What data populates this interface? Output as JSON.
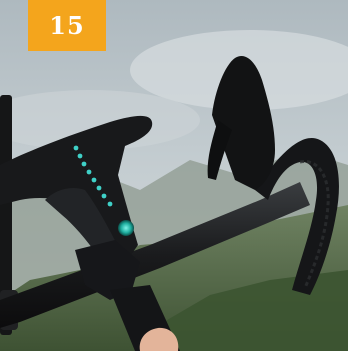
{
  "badge": {
    "number": "15",
    "bg_color": "#F4A51C",
    "text_color": "#FFFFFF"
  },
  "photo": {
    "subject": "bike-handlebar-with-led-light-strip",
    "led_color": "#3FD0C7",
    "sky_color": "#BFC8CC",
    "hill_color": "#5E7451"
  }
}
